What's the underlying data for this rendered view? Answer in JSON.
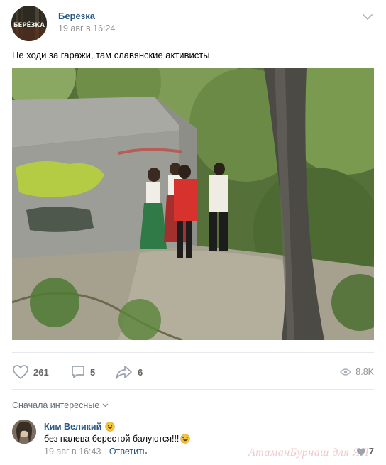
{
  "post": {
    "group_name": "Берёзка",
    "avatar_text": "БЕРЁЗКА",
    "date": "19 авг в 16:24",
    "text": "Не ходи за гаражи, там славянские активисты",
    "likes": "261",
    "comments": "5",
    "shares": "6",
    "views": "8.8K"
  },
  "comments_section": {
    "sort_label": "Сначала интересные",
    "comment": {
      "author": "Ким Великий",
      "text": "без палева берестой балуются!!!",
      "date": "19 авг в 16:43",
      "reply_label": "Ответить",
      "likes": "7"
    }
  },
  "watermark": "АтаманБурнаш для ЯП",
  "colors": {
    "link": "#2a5885",
    "meta": "#939393",
    "divider": "#e7e8ec"
  }
}
